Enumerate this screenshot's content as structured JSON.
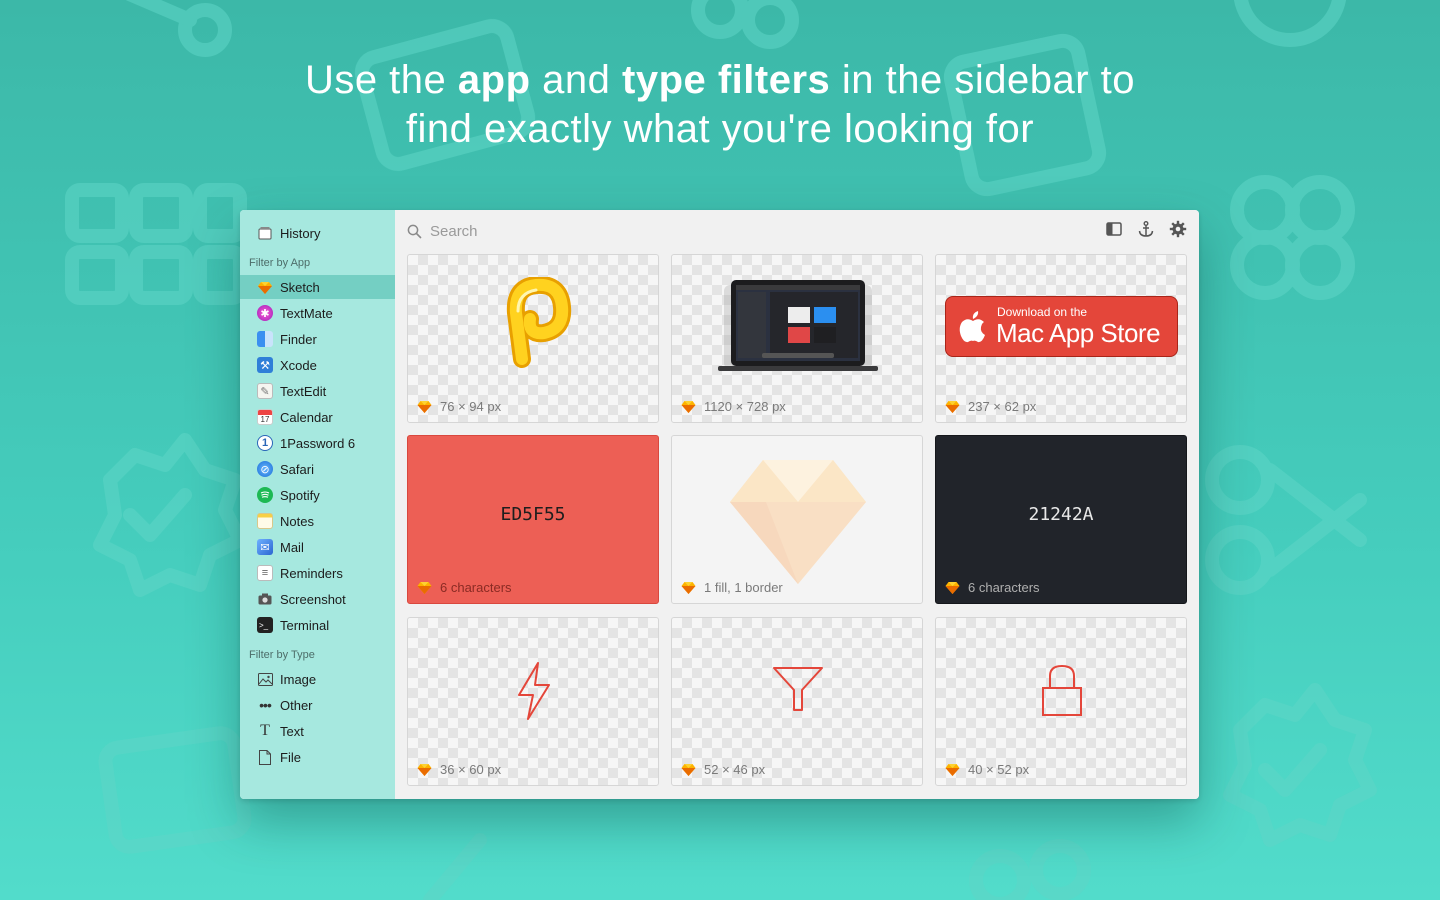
{
  "headline": {
    "line1_pre": "Use the ",
    "line1_bold1": "app",
    "line1_mid": " and ",
    "line1_bold2": "type filters",
    "line1_post": " in the sidebar to",
    "line2": "find exactly what you're looking for"
  },
  "sidebar": {
    "history": {
      "label": "History",
      "icon": "history-icon"
    },
    "filter_by_app_heading": "Filter by App",
    "apps": [
      {
        "label": "Sketch",
        "icon": "sketch-icon",
        "selected": true
      },
      {
        "label": "TextMate",
        "icon": "textmate-icon"
      },
      {
        "label": "Finder",
        "icon": "finder-icon"
      },
      {
        "label": "Xcode",
        "icon": "xcode-icon"
      },
      {
        "label": "TextEdit",
        "icon": "textedit-icon"
      },
      {
        "label": "Calendar",
        "icon": "calendar-icon"
      },
      {
        "label": "1Password 6",
        "icon": "1password-icon"
      },
      {
        "label": "Safari",
        "icon": "safari-icon"
      },
      {
        "label": "Spotify",
        "icon": "spotify-icon"
      },
      {
        "label": "Notes",
        "icon": "notes-icon"
      },
      {
        "label": "Mail",
        "icon": "mail-icon"
      },
      {
        "label": "Reminders",
        "icon": "reminders-icon"
      },
      {
        "label": "Screenshot",
        "icon": "camera-icon"
      },
      {
        "label": "Terminal",
        "icon": "terminal-icon"
      }
    ],
    "filter_by_type_heading": "Filter by Type",
    "types": [
      {
        "label": "Image",
        "icon": "image-icon"
      },
      {
        "label": "Other",
        "icon": "ellipsis-icon"
      },
      {
        "label": "Text",
        "icon": "text-icon"
      },
      {
        "label": "File",
        "icon": "file-icon"
      }
    ]
  },
  "toolbar": {
    "search_placeholder": "Search",
    "icons": [
      "sidebar-toggle-icon",
      "anchor-icon",
      "gear-icon"
    ]
  },
  "cards": [
    {
      "caption": "76 × 94 px",
      "kind": "image",
      "content": "paperclip-image"
    },
    {
      "caption": "1120 × 728 px",
      "kind": "image",
      "content": "laptop-image"
    },
    {
      "caption": "237 × 62 px",
      "kind": "image",
      "content": "app-store-badge",
      "badge_small": "Download on the",
      "badge_big": "Mac App Store"
    },
    {
      "caption": "6 characters",
      "kind": "color",
      "hex": "ED5F55",
      "bg": "#ED5F55",
      "fg": "#1e1e1e",
      "caption_color": "#8a2b24"
    },
    {
      "caption": "1 fill, 1 border",
      "kind": "shape",
      "content": "diamond-shape"
    },
    {
      "caption": "6 characters",
      "kind": "color",
      "hex": "21242A",
      "bg": "#21242A",
      "fg": "#e8e8e8",
      "caption_color": "#b0b0b0"
    },
    {
      "caption": "36 × 60 px",
      "kind": "image",
      "content": "bolt-icon"
    },
    {
      "caption": "52 × 46 px",
      "kind": "image",
      "content": "funnel-icon"
    },
    {
      "caption": "40 × 52 px",
      "kind": "image",
      "content": "lock-icon"
    }
  ],
  "colors": {
    "background": "#3cb8a8",
    "sidebar": "#a6e8df",
    "sidebar_selected": "#74cfc3",
    "icon_red": "#e4463a"
  }
}
